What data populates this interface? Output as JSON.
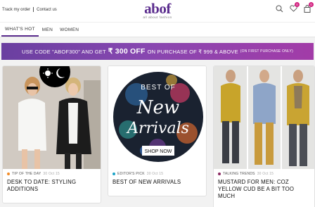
{
  "top_links": {
    "track_order": "Track my order",
    "contact": "Contact us"
  },
  "logo": {
    "word": "abof",
    "tagline": "all about fashion"
  },
  "header_icons": {
    "wishlist_count": "0",
    "bag_count": "0",
    "icons": [
      "search-icon",
      "heart-icon",
      "bag-icon"
    ]
  },
  "nav": {
    "tabs": [
      "WHAT'S HOT",
      "MEN",
      "WOMEN"
    ]
  },
  "promo": {
    "prefix": "USE CODE \"ABOF300\" AND GET",
    "amount": "₹ 300 OFF",
    "suffix": "ON PURCHASE OF ₹ 999 & ABOVE",
    "note": "(ON FIRST PURCHASE ONLY)"
  },
  "cards": [
    {
      "category": "TIP OF THE DAY",
      "date": "30 Oct 15",
      "title": "DESK TO DATE: STYLING ADDITIONS",
      "dot_color": "#f28c28"
    },
    {
      "category": "EDITOR'S PICK",
      "date": "30 Oct 15",
      "title": "BEST OF NEW ARRIVALS",
      "dot_color": "#1aa3c7",
      "image_text": {
        "line1": "BEST OF",
        "line2": "New",
        "line3": "Arrivals",
        "button": "SHOP NOW"
      }
    },
    {
      "category": "TALKING TRENDS",
      "date": "30 Oct 15",
      "title": "MUSTARD FOR MEN: COZ YELLOW CUD BE A BIT TOO MUCH",
      "dot_color": "#8b2a62"
    }
  ],
  "colors": {
    "brand": "#5b2d8e",
    "badge": "#d11c7d"
  }
}
